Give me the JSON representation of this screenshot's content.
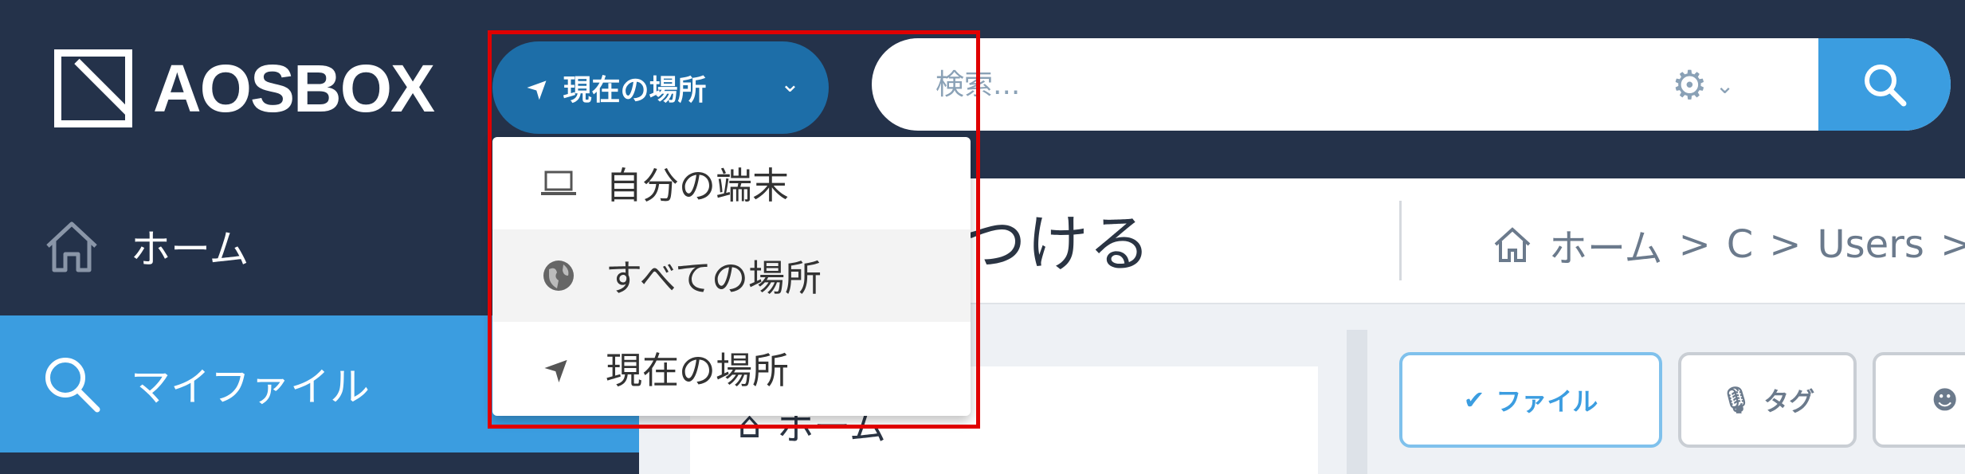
{
  "app": {
    "logo_text": "AOSBOX",
    "colors": {
      "topbar": "#24324a",
      "accent": "#3b9de0",
      "location_button": "#1d6ea8",
      "highlight": "#e00000"
    }
  },
  "header": {
    "location_button": {
      "label": "現在の場所",
      "icon": "location-arrow-icon",
      "chevron": "⌄"
    },
    "search": {
      "placeholder": "検索...",
      "settings_icon": "gear-icon",
      "button_icon": "search-icon"
    }
  },
  "location_dropdown": {
    "items": [
      {
        "label": "自分の端末",
        "icon": "laptop-icon"
      },
      {
        "label": "すべての場所",
        "icon": "globe-icon"
      },
      {
        "label": "現在の場所",
        "icon": "location-arrow-icon"
      }
    ]
  },
  "sidebar": {
    "items": [
      {
        "label": "ホーム",
        "icon": "home-icon",
        "active": false
      },
      {
        "label": "マイファイル",
        "icon": "search-icon",
        "active": true
      }
    ]
  },
  "main": {
    "title": "見つける",
    "title_visible": "見つける",
    "breadcrumb": [
      "ホーム",
      "C",
      "Users"
    ],
    "panel_home_label": "ホーム",
    "filters": [
      {
        "label": "ファイル",
        "icon": "check-icon",
        "selected": true
      },
      {
        "label": "タグ",
        "icon": "microphone-icon",
        "selected": false
      },
      {
        "label": "",
        "icon": "smiley-icon",
        "selected": false
      }
    ]
  }
}
